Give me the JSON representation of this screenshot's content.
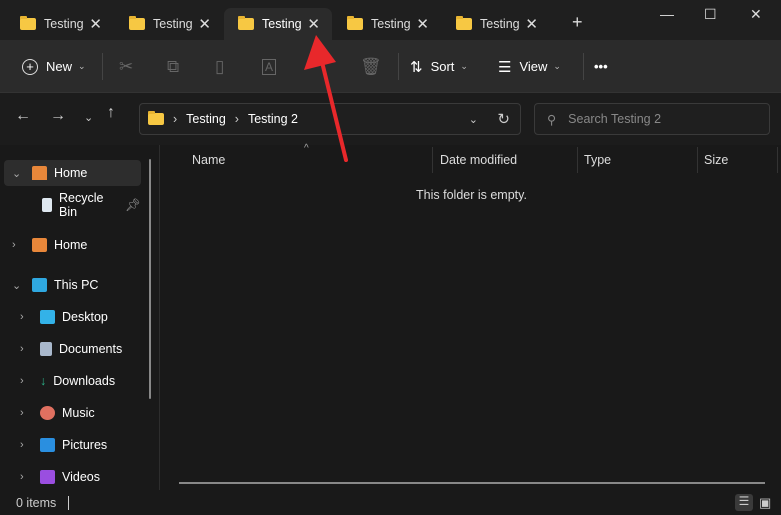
{
  "tabs": [
    {
      "label": "Testing"
    },
    {
      "label": "Testing"
    },
    {
      "label": "Testing"
    },
    {
      "label": "Testing"
    },
    {
      "label": "Testing"
    }
  ],
  "new_tab": "+",
  "window": {
    "minimize": "—",
    "maximize": "☐",
    "close": "✕"
  },
  "toolbar": {
    "new": "New",
    "sort": "Sort",
    "view": "View",
    "more": "•••"
  },
  "address": {
    "crumbs": [
      "Testing",
      "Testing 2"
    ]
  },
  "search": {
    "placeholder": "Search Testing 2"
  },
  "nav_items": [
    {
      "label": "Home"
    },
    {
      "label": "Recycle Bin"
    },
    {
      "label": "Home"
    },
    {
      "label": "This PC"
    },
    {
      "label": "Desktop"
    },
    {
      "label": "Documents"
    },
    {
      "label": "Downloads"
    },
    {
      "label": "Music"
    },
    {
      "label": "Pictures"
    },
    {
      "label": "Videos"
    }
  ],
  "columns": [
    "Name",
    "Date modified",
    "Type",
    "Size"
  ],
  "empty_message": "This folder is empty.",
  "status": {
    "items": "0 items"
  },
  "colors": {
    "annotation_arrow": "#e8282b"
  }
}
